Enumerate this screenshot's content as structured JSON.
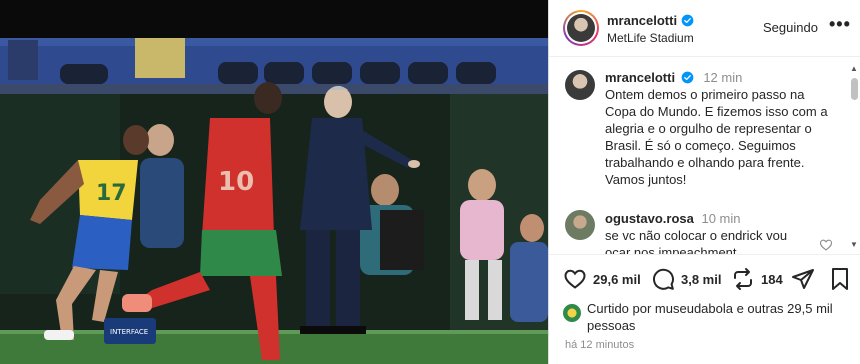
{
  "photo": {
    "jersey_number_front": "17",
    "jersey_number_back": "10",
    "banner_text": "INTERFACE"
  },
  "header": {
    "username": "mrancelotti",
    "location": "MetLife Stadium",
    "follow_label": "Seguindo",
    "more_label": "•••",
    "verified_color": "#0095f6"
  },
  "caption": {
    "username": "mrancelotti",
    "time": "12 min",
    "text": "Ontem demos o primeiro passo na\nCopa do Mundo. E fizemos isso com a\nalegria e o orgulho de representar o\nBrasil. É só o começo. Seguimos\ntrabalhando e olhando para frente.\nVamos juntos!"
  },
  "comment": {
    "username": "ogustavo.rosa",
    "time": "10 min",
    "text": "se vc não colocar o endrick vou\nocar nos impeachment"
  },
  "actions": {
    "likes": "29,6 mil",
    "comments": "3,8 mil",
    "reposts": "184"
  },
  "liked_by": {
    "text": "Curtido por museudabola e outras 29,5 mil\npessoas"
  },
  "time_ago": "há 12 minutos"
}
